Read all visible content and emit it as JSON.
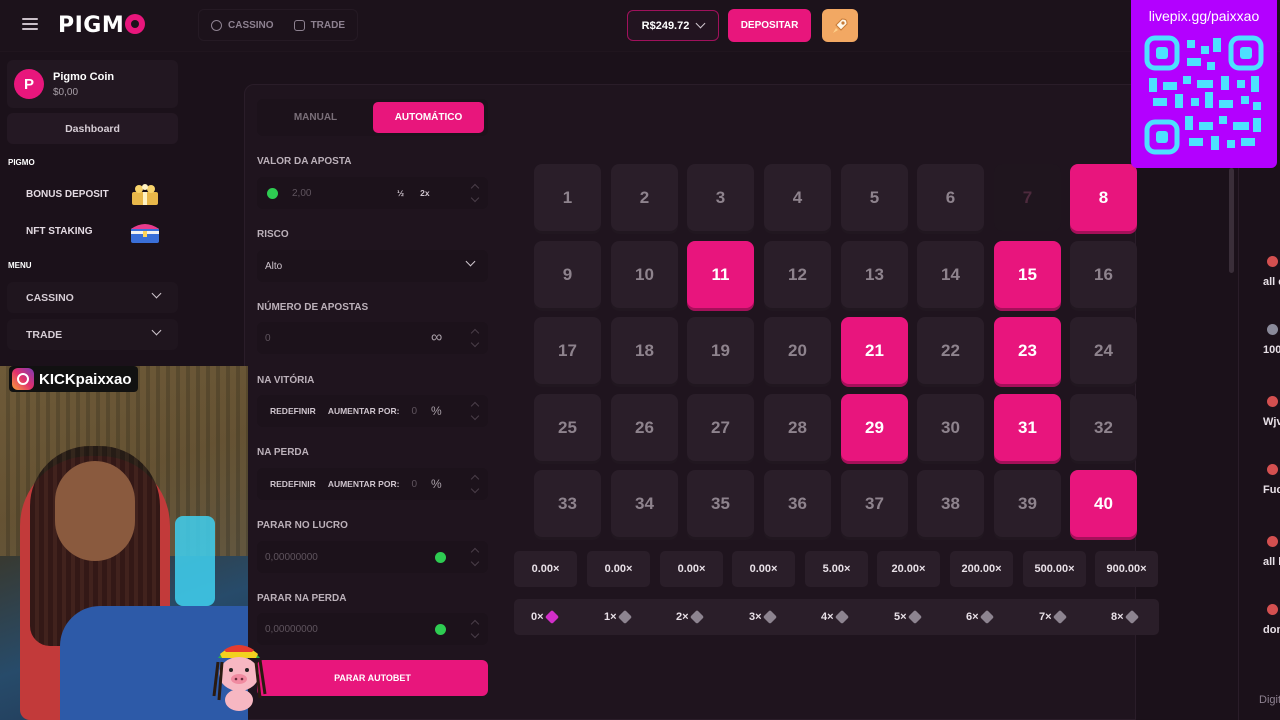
{
  "topbar": {
    "logo": "PIGM",
    "nav": [
      {
        "label": "CASSINO",
        "icon": "casino-icon"
      },
      {
        "label": "TRADE",
        "icon": "trade-icon"
      }
    ],
    "balance": "R$249.72",
    "deposit_label": "DEPOSITAR",
    "rocket_icon": "rocket-icon"
  },
  "sidebar": {
    "user_name": "Pigmo Coin",
    "user_balance": "$0,00",
    "avatar_letter": "P",
    "dashboard_label": "Dashboard",
    "pigmo_section": "PIGMO",
    "promos": [
      {
        "label": "BONUS DEPOSIT",
        "icon": "gift-icon"
      },
      {
        "label": "NFT STAKING",
        "icon": "chest-icon"
      }
    ],
    "menu_section": "MENU",
    "menu": [
      {
        "label": "CASSINO"
      },
      {
        "label": "TRADE"
      }
    ]
  },
  "overlay": {
    "instagram": "KICKpaixxao",
    "qr_text": "livepix.gg/paixxao"
  },
  "controls": {
    "tab_manual": "MANUAL",
    "tab_auto": "AUTOMÁTICO",
    "bet_label": "VALOR DA APOSTA",
    "bet_value": "2,00",
    "half_label": "½",
    "double_label": "2x",
    "risk_label": "RISCO",
    "risk_value": "Alto",
    "num_bets_label": "NÚMERO DE APOSTAS",
    "num_bets_value": "0",
    "infinity": "∞",
    "on_win_label": "NA VITÓRIA",
    "on_loss_label": "NA PERDA",
    "reset_label": "REDEFINIR",
    "increase_label": "AUMENTAR POR:",
    "percent": "%",
    "win_value": "0",
    "loss_value": "0",
    "stop_profit_label": "PARAR NO LUCRO",
    "stop_profit_value": "0,00000000",
    "stop_loss_label": "PARAR NA PERDA",
    "stop_loss_value": "0,00000000",
    "stop_autobet_label": "PARAR AUTOBET"
  },
  "grid": {
    "tiles": [
      {
        "n": "1"
      },
      {
        "n": "2"
      },
      {
        "n": "3"
      },
      {
        "n": "4"
      },
      {
        "n": "5"
      },
      {
        "n": "6"
      },
      {
        "n": "7",
        "state": "dim"
      },
      {
        "n": "8",
        "state": "sel"
      },
      {
        "n": "9"
      },
      {
        "n": "10"
      },
      {
        "n": "11",
        "state": "sel"
      },
      {
        "n": "12"
      },
      {
        "n": "13"
      },
      {
        "n": "14"
      },
      {
        "n": "15",
        "state": "sel"
      },
      {
        "n": "16"
      },
      {
        "n": "17"
      },
      {
        "n": "18"
      },
      {
        "n": "19"
      },
      {
        "n": "20"
      },
      {
        "n": "21",
        "state": "sel"
      },
      {
        "n": "22"
      },
      {
        "n": "23",
        "state": "sel"
      },
      {
        "n": "24"
      },
      {
        "n": "25"
      },
      {
        "n": "26"
      },
      {
        "n": "27"
      },
      {
        "n": "28"
      },
      {
        "n": "29",
        "state": "sel"
      },
      {
        "n": "30"
      },
      {
        "n": "31",
        "state": "sel"
      },
      {
        "n": "32"
      },
      {
        "n": "33"
      },
      {
        "n": "34"
      },
      {
        "n": "35"
      },
      {
        "n": "36"
      },
      {
        "n": "37"
      },
      {
        "n": "38"
      },
      {
        "n": "39"
      },
      {
        "n": "40",
        "state": "sel"
      }
    ],
    "multipliers": [
      "0.00×",
      "0.00×",
      "0.00×",
      "0.00×",
      "5.00×",
      "20.00×",
      "200.00×",
      "500.00×",
      "900.00×"
    ],
    "hits": [
      "0×",
      "1×",
      "2×",
      "3×",
      "4×",
      "5×",
      "6×",
      "7×",
      "8×"
    ]
  },
  "chat": {
    "items": [
      "all c",
      "100",
      "Wjv",
      "Fuc",
      "all l",
      "don"
    ],
    "input_placeholder": "Digit"
  },
  "colors": {
    "accent": "#e8167c",
    "background": "#1b111a",
    "tile": "#2a1e29",
    "qr_bg": "#b300ff"
  }
}
